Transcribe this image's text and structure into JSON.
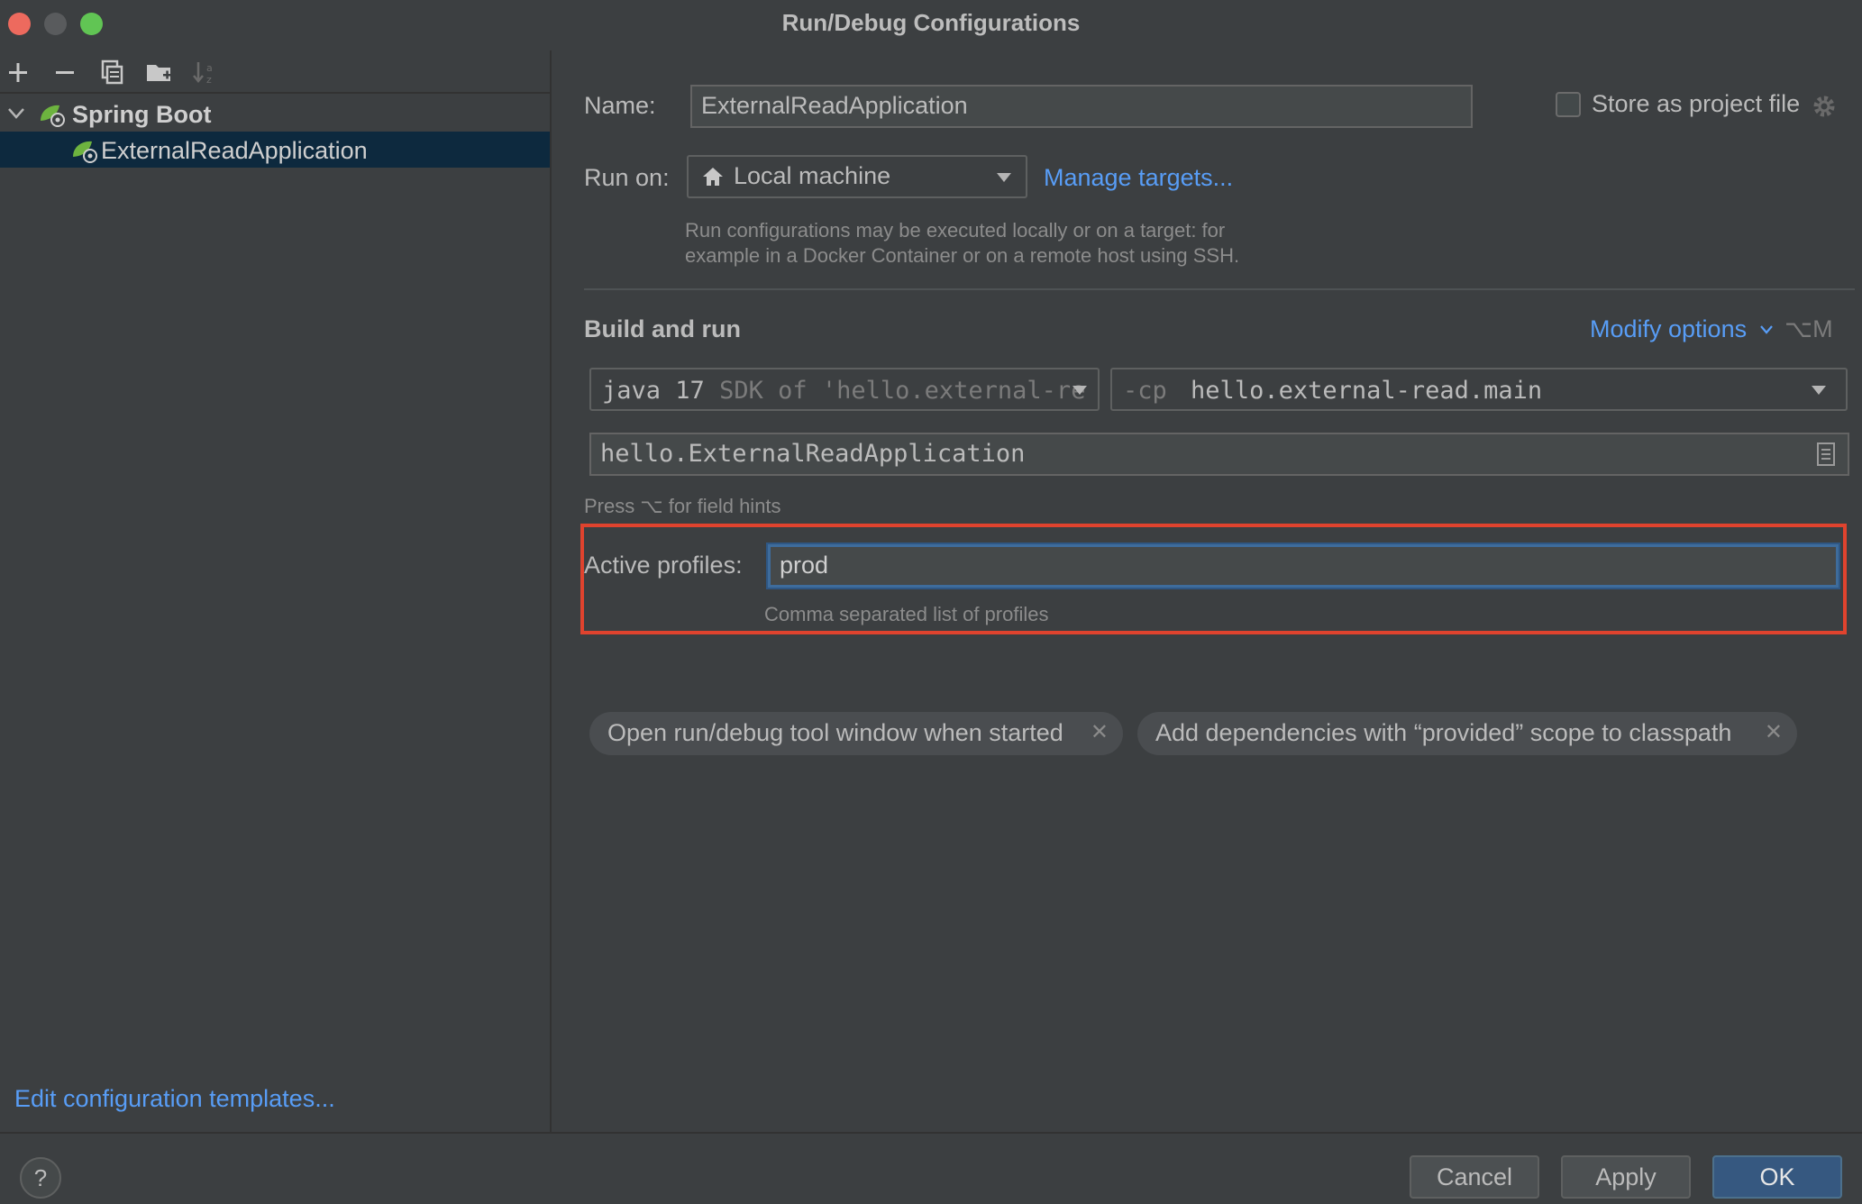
{
  "window": {
    "title": "Run/Debug Configurations"
  },
  "left_panel": {
    "tree": {
      "group_label": "Spring Boot",
      "items": [
        {
          "label": "ExternalReadApplication"
        }
      ]
    },
    "edit_templates_link": "Edit configuration templates..."
  },
  "form": {
    "name_label": "Name:",
    "name_value": "ExternalReadApplication",
    "store_label": "Store as project file",
    "run_on_label": "Run on:",
    "run_on_value": "Local machine",
    "manage_targets_link": "Manage targets...",
    "run_on_hint_line1": "Run configurations may be executed locally or on a target: for",
    "run_on_hint_line2": "example in a Docker Container or on a remote host using SSH.",
    "section_title": "Build and run",
    "modify_options_link": "Modify options",
    "modify_options_shortcut": "⌥M",
    "jdk_value": "java 17",
    "jdk_detail": "SDK of 'hello.external-re",
    "cp_prefix": "-cp",
    "cp_value": "hello.external-read.main",
    "main_class_value": "hello.ExternalReadApplication",
    "field_hints": "Press ⌥ for field hints",
    "active_profiles_label": "Active profiles:",
    "active_profiles_value": "prod",
    "active_profiles_hint": "Comma separated list of profiles",
    "chips": [
      {
        "label": "Open run/debug tool window when started"
      },
      {
        "label": "Add dependencies with “provided” scope to classpath"
      }
    ]
  },
  "footer": {
    "help_label": "?",
    "cancel_label": "Cancel",
    "apply_label": "Apply",
    "ok_label": "OK"
  },
  "colors": {
    "background": "#3c3f41",
    "link": "#589df6",
    "selection": "#0d293e",
    "highlight": "#e0432e",
    "ok_button": "#365880"
  }
}
